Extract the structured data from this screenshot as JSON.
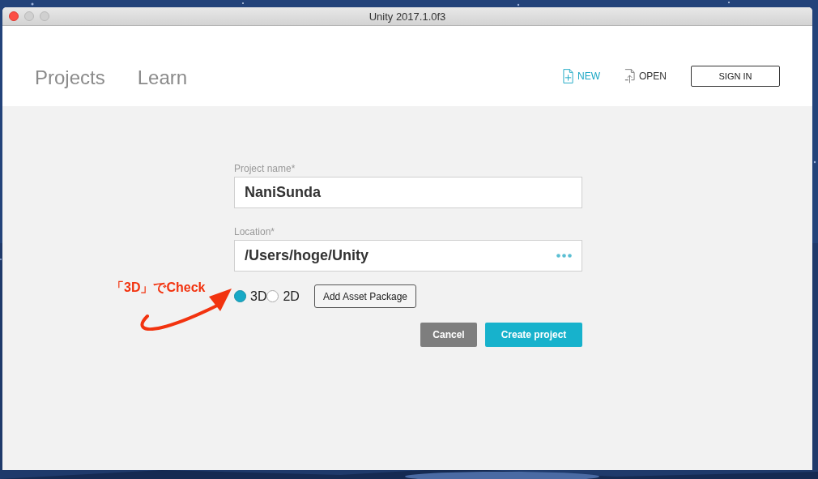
{
  "window": {
    "title": "Unity 2017.1.0f3"
  },
  "tabs": [
    {
      "label": "Projects"
    },
    {
      "label": "Learn"
    }
  ],
  "header_actions": [
    {
      "label": "NEW",
      "kind": "new",
      "selected": true
    },
    {
      "label": "OPEN",
      "kind": "open",
      "selected": false
    },
    {
      "label": "SIGN IN",
      "kind": "outlined",
      "selected": false
    }
  ],
  "form": {
    "fields": [
      {
        "label": "Project name*",
        "value": "NaniSunda",
        "kind": "text"
      },
      {
        "label": "Location*",
        "value": "/Users/hoge/Unity",
        "kind": "browse"
      }
    ],
    "templates": [
      {
        "label": "3D",
        "selected": true
      },
      {
        "label": "2D",
        "selected": false
      }
    ],
    "asset_button": "Add Asset Package",
    "buttons": [
      {
        "label": "Cancel",
        "kind": "secondary"
      },
      {
        "label": "Create project",
        "kind": "primary"
      }
    ]
  },
  "annotation": {
    "text": "「3D」でCheck"
  }
}
